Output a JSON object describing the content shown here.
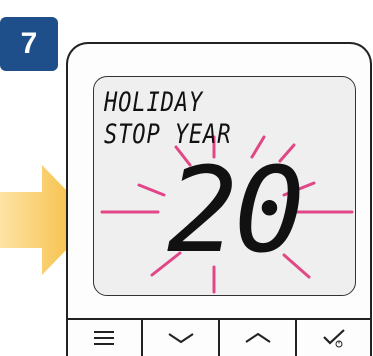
{
  "step": {
    "number": "7"
  },
  "screen": {
    "line1": "HOLIDAY",
    "line2": "STOP YEAR",
    "value": "20"
  },
  "colors": {
    "badge": "#1f4f8a",
    "arrow": "#f5b731",
    "ray": "#e0357b"
  },
  "buttons": [
    {
      "icon": "menu-icon"
    },
    {
      "icon": "chevron-down-icon"
    },
    {
      "icon": "chevron-up-icon"
    },
    {
      "icon": "check-power-icon"
    }
  ]
}
